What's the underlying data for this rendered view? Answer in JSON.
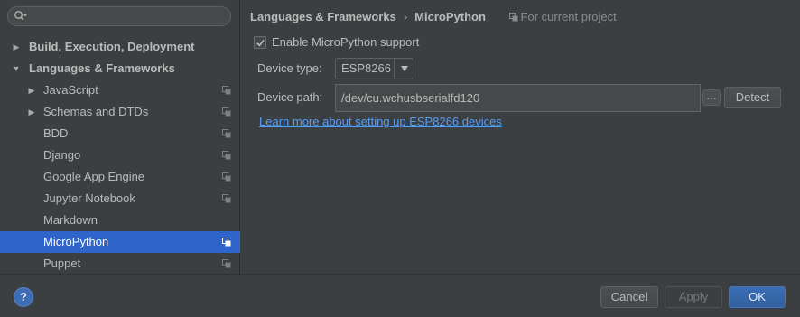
{
  "sidebar": {
    "search": {
      "value": "",
      "placeholder": ""
    },
    "items": [
      {
        "label": "Build, Execution, Deployment",
        "arrow": "▶",
        "bold": true,
        "level": 0,
        "copy": false
      },
      {
        "label": "Languages & Frameworks",
        "arrow": "▼",
        "bold": true,
        "level": 0,
        "copy": false
      },
      {
        "label": "JavaScript",
        "arrow": "▶",
        "bold": false,
        "level": 1,
        "copy": true
      },
      {
        "label": "Schemas and DTDs",
        "arrow": "▶",
        "bold": false,
        "level": 1,
        "copy": true
      },
      {
        "label": "BDD",
        "arrow": "",
        "bold": false,
        "level": 1,
        "copy": true
      },
      {
        "label": "Django",
        "arrow": "",
        "bold": false,
        "level": 1,
        "copy": true
      },
      {
        "label": "Google App Engine",
        "arrow": "",
        "bold": false,
        "level": 1,
        "copy": true
      },
      {
        "label": "Jupyter Notebook",
        "arrow": "",
        "bold": false,
        "level": 1,
        "copy": true
      },
      {
        "label": "Markdown",
        "arrow": "",
        "bold": false,
        "level": 1,
        "copy": false
      },
      {
        "label": "MicroPython",
        "arrow": "",
        "bold": false,
        "level": 1,
        "copy": true,
        "selected": true
      },
      {
        "label": "Puppet",
        "arrow": "",
        "bold": false,
        "level": 1,
        "copy": true
      }
    ]
  },
  "header": {
    "crumb_parent": "Languages & Frameworks",
    "crumb_separator": "›",
    "crumb_current": "MicroPython",
    "scope_label": "For current project"
  },
  "form": {
    "enable_label": "Enable MicroPython support",
    "enable_checked": true,
    "device_type_label": "Device type:",
    "device_type_value": "ESP8266",
    "device_path_label": "Device path:",
    "device_path_value": "/dev/cu.wchusbserialfd120",
    "browse_label": "…",
    "detect_label": "Detect",
    "learn_more": "Learn more about setting up ESP8266 devices"
  },
  "footer": {
    "help_label": "?",
    "cancel_label": "Cancel",
    "apply_label": "Apply",
    "ok_label": "OK"
  },
  "colors": {
    "background": "#3c3f41",
    "selection": "#2f65ca",
    "link": "#589df6",
    "primary_button": "#3a6eb5"
  },
  "icons": {
    "search": "search-icon",
    "copy": "copy-icon",
    "scope": "copy-icon",
    "checkbox": "checkmark-icon",
    "dropdown": "triangle-down-icon",
    "help": "help-icon"
  }
}
